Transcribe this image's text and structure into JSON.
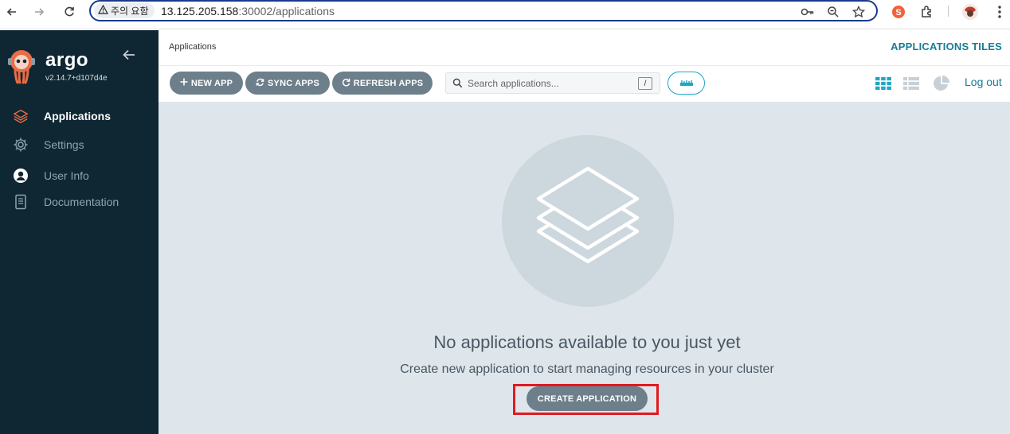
{
  "browser": {
    "security_label": "주의 요함",
    "url_host": "13.125.205.158",
    "url_rest": ":30002/applications",
    "icons": [
      "back-icon",
      "forward-icon",
      "reload-icon",
      "warning-icon",
      "key-icon",
      "zoom-icon",
      "star-icon",
      "extension-icon",
      "puzzle-icon",
      "profile-icon",
      "menu-icon"
    ]
  },
  "sidebar": {
    "brand": "argo",
    "version": "v2.14.7+d107d4e",
    "items": [
      {
        "label": "Applications",
        "icon": "layers-icon",
        "active": true
      },
      {
        "label": "Settings",
        "icon": "gear-icon",
        "active": false
      },
      {
        "label": "User Info",
        "icon": "user-icon",
        "active": false
      },
      {
        "label": "Documentation",
        "icon": "book-icon",
        "active": false
      }
    ]
  },
  "header": {
    "breadcrumb": "Applications",
    "view_title": "APPLICATIONS TILES"
  },
  "toolbar": {
    "new_app": "NEW APP",
    "sync_apps": "SYNC APPS",
    "refresh_apps": "REFRESH APPS",
    "search_placeholder": "Search applications...",
    "search_shortcut": "/",
    "logout": "Log out"
  },
  "empty_state": {
    "title": "No applications available to you just yet",
    "subtitle": "Create new application to start managing resources in your cluster",
    "create_button": "CREATE APPLICATION"
  },
  "colors": {
    "sidebar_bg": "#0f2733",
    "accent": "#167c95",
    "button_bg": "#6d7f8b",
    "content_bg": "#dee6eb",
    "highlight": "#e01a22"
  }
}
